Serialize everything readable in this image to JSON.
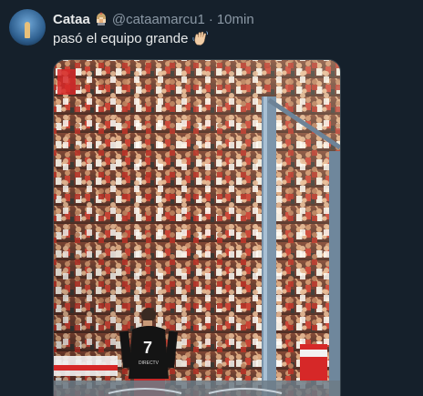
{
  "tweet": {
    "display_name": "Cataa",
    "handle": "@cataamarcu1",
    "separator": "·",
    "time": "10min",
    "text": "pasó el equipo grande",
    "badge_icon": "helmet-emoji-icon",
    "text_emoji_icon": "waving-hand-emoji-icon"
  },
  "media": {
    "player_number": "7",
    "player_shirt_text": "DIRECTV",
    "accent_red": "#d62828",
    "accent_white": "#f2f2f2"
  }
}
